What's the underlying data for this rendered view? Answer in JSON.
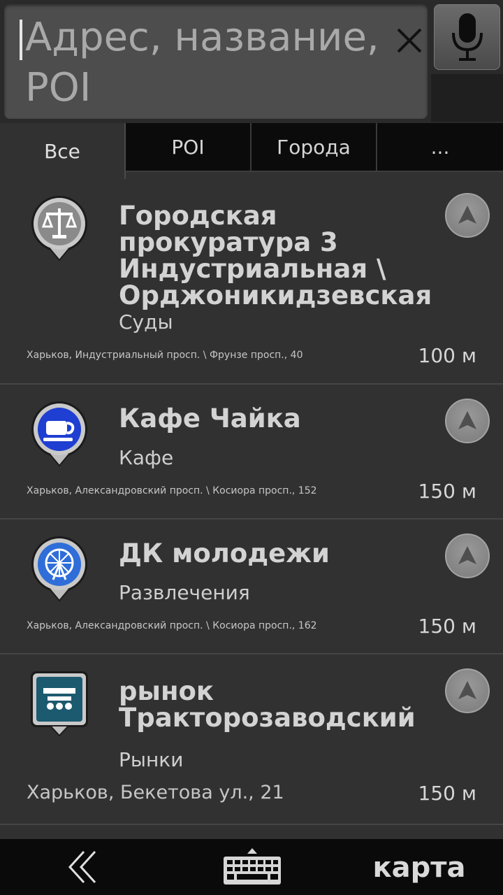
{
  "search": {
    "value": "",
    "placeholder": "Адрес, название, POI"
  },
  "tabs": [
    {
      "label": "Все",
      "active": true
    },
    {
      "label": "POI",
      "active": false
    },
    {
      "label": "Города",
      "active": false
    },
    {
      "label": "...",
      "active": false
    }
  ],
  "results": [
    {
      "title": "Городская прокуратура 3 Индустриальная \\ Орджоникидзевская",
      "category": "Суды",
      "address": "Харьков, Индустриальный просп. \\ Фрунзе просп., 40",
      "distance": "100 м",
      "icon": "court-scales-icon",
      "color": "#8a8a8a"
    },
    {
      "title": "Кафе Чайка",
      "category": "Кафе",
      "address": "Харьков, Александровский просп. \\ Косиора просп., 152",
      "distance": "150 м",
      "icon": "coffee-cup-icon",
      "color": "#1e3fd1"
    },
    {
      "title": "ДК молодежи",
      "category": "Развлечения",
      "address": "Харьков, Александровский просп. \\ Косиора просп., 162",
      "distance": "150 м",
      "icon": "ferris-wheel-icon",
      "color": "#2f6ed8"
    },
    {
      "title": "рынок Тракторозаводский",
      "category": "Рынки",
      "address": "Харьков, Бекетова ул., 21",
      "distance": "150 м",
      "icon": "market-icon",
      "color": "#1c5a70"
    }
  ],
  "bottom_bar": {
    "map_label": "карта"
  }
}
